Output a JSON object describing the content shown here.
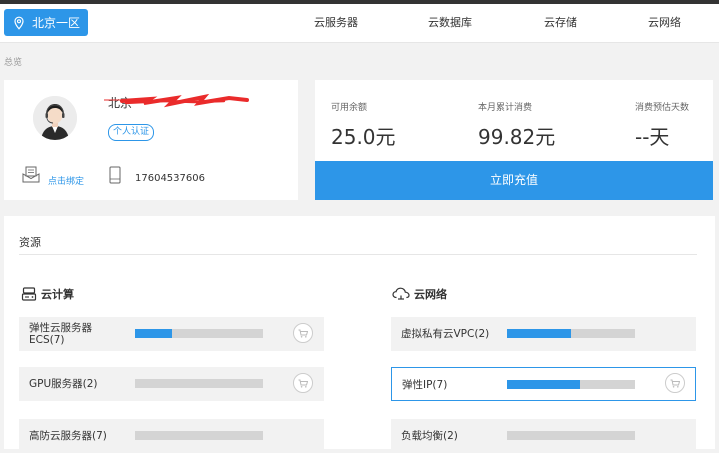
{
  "topbar": {
    "region": "北京一区",
    "nav": [
      "云服务器",
      "云数据库",
      "云存储",
      "云网络"
    ]
  },
  "breadcrumb": "总览",
  "user": {
    "name": "北京",
    "badge": "个人认证",
    "bind_link": "点击绑定",
    "phone": "17604537606"
  },
  "balance": {
    "stats": [
      {
        "label": "可用余额",
        "value": "25.0元"
      },
      {
        "label": "本月累计消费",
        "value": "99.82元"
      },
      {
        "label": "消费预估天数",
        "value": "--天"
      }
    ],
    "recharge_label": "立即充值"
  },
  "resources": {
    "title": "资源",
    "compute": {
      "title": "云计算",
      "items": [
        {
          "name": "弹性云服务器\nECS(7)",
          "usage": 0.29
        },
        {
          "name": "GPU服务器(2)",
          "usage": 0.0
        },
        {
          "name": "高防云服务器(7)",
          "usage": 0.0
        }
      ]
    },
    "network": {
      "title": "云网络",
      "items": [
        {
          "name": "虚拟私有云VPC(2)",
          "usage": 0.5
        },
        {
          "name": "弹性IP(7)",
          "usage": 0.57
        },
        {
          "name": "负载均衡(2)",
          "usage": 0.0
        }
      ]
    }
  },
  "colors": {
    "accent": "#2d96e8",
    "bar_bg": "#d4d4d4"
  },
  "icons": [
    "location-pin-icon",
    "avatar",
    "mail-icon",
    "phone-icon",
    "server-icon",
    "cloud-icon",
    "cart-icon"
  ]
}
